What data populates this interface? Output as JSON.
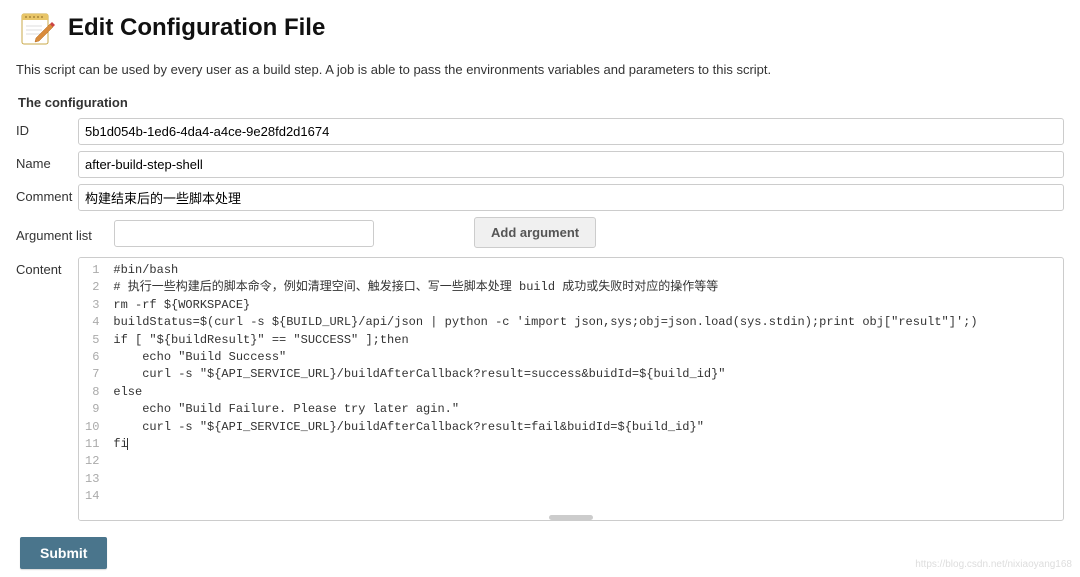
{
  "header": {
    "title": "Edit Configuration File"
  },
  "description": "This script can be used by every user as a build step. A job is able to pass the environments variables and parameters to this script.",
  "section_title": "The configuration",
  "fields": {
    "id_label": "ID",
    "id_value": "5b1d054b-1ed6-4da4-a4ce-9e28fd2d1674",
    "name_label": "Name",
    "name_value": "after-build-step-shell",
    "comment_label": "Comment",
    "comment_value": "构建结束后的一些脚本处理",
    "argument_label": "Argument list",
    "argument_value": "",
    "add_argument_label": "Add argument",
    "content_label": "Content"
  },
  "code_lines": [
    "#bin/bash",
    "",
    "# 执行一些构建后的脚本命令，例如清理空间、触发接口、写一些脚本处理 build 成功或失败时对应的操作等等",
    "",
    "rm -rf ${WORKSPACE}",
    "",
    "buildStatus=$(curl -s ${BUILD_URL}/api/json | python -c 'import json,sys;obj=json.load(sys.stdin);print obj[\"result\"]';)",
    "if [ \"${buildResult}\" == \"SUCCESS\" ];then",
    "    echo \"Build Success\"",
    "    curl -s \"${API_SERVICE_URL}/buildAfterCallback?result=success&buidId=${build_id}\"",
    "else",
    "    echo \"Build Failure. Please try later agin.\"",
    "    curl -s \"${API_SERVICE_URL}/buildAfterCallback?result=fail&buidId=${build_id}\"",
    "fi"
  ],
  "submit_label": "Submit",
  "watermark": "https://blog.csdn.net/nixiaoyang168"
}
